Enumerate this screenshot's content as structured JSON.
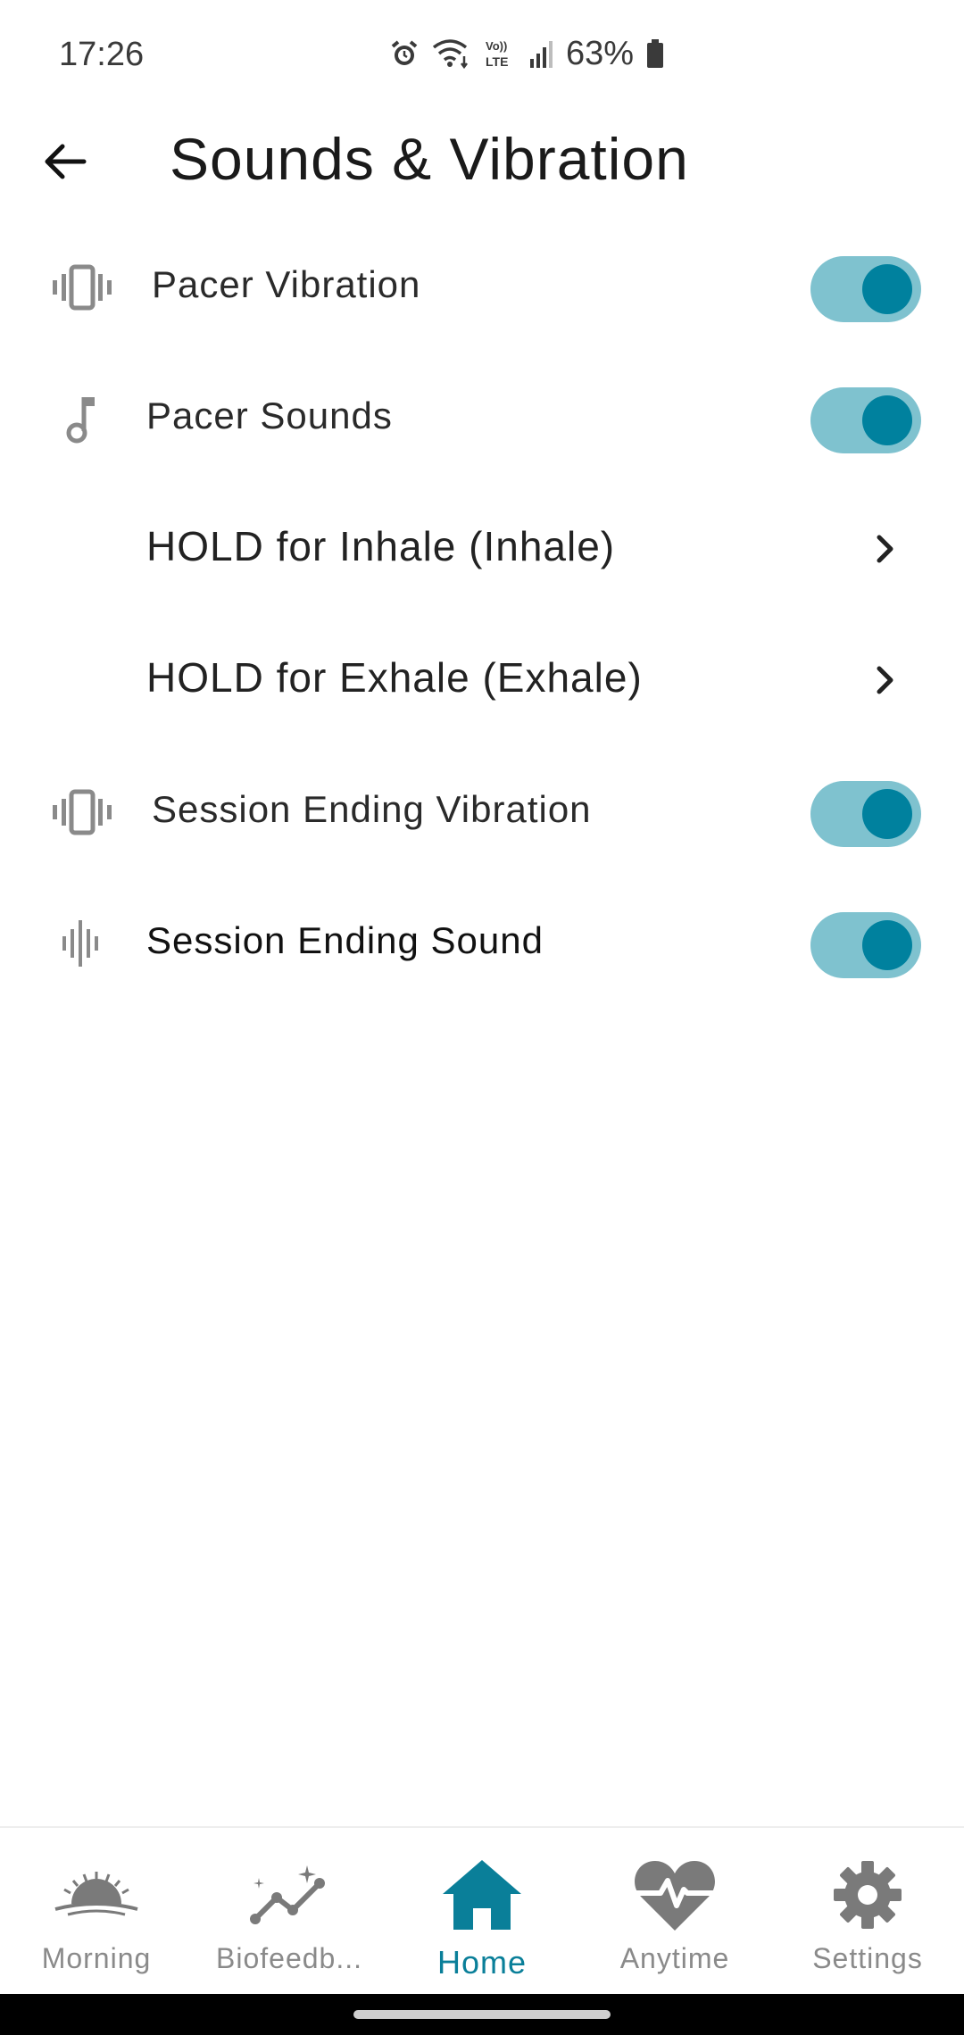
{
  "status_bar": {
    "time": "17:26",
    "battery": "63%",
    "icons": [
      "alarm-icon",
      "wifi-icon",
      "volte-icon",
      "signal-icon",
      "battery-icon"
    ],
    "volte_text": "Vo)) LTE"
  },
  "header": {
    "title": "Sounds & Vibration",
    "back_icon": "arrow-left-icon"
  },
  "settings": {
    "pacer_vibration": {
      "label": "Pacer Vibration",
      "icon": "vibration-icon",
      "enabled": true
    },
    "pacer_sounds": {
      "label": "Pacer Sounds",
      "icon": "music-note-icon",
      "enabled": true
    },
    "inhale_sound": {
      "label": "HOLD for Inhale (Inhale)",
      "icon": "chevron-right-icon"
    },
    "exhale_sound": {
      "label": "HOLD for Exhale (Exhale)",
      "icon": "chevron-right-icon"
    },
    "session_ending_vibration": {
      "label": "Session Ending Vibration",
      "icon": "vibration-icon",
      "enabled": true
    },
    "session_ending_sound": {
      "label": "Session Ending Sound",
      "icon": "sound-wave-icon",
      "enabled": true
    }
  },
  "bottom_nav": {
    "items": [
      {
        "label": "Morning",
        "icon": "sunrise-icon",
        "active": false
      },
      {
        "label": "Biofeedb...",
        "icon": "sparkle-chart-icon",
        "active": false
      },
      {
        "label": "Home",
        "icon": "home-icon",
        "active": true
      },
      {
        "label": "Anytime",
        "icon": "heartbeat-icon",
        "active": false
      },
      {
        "label": "Settings",
        "icon": "gear-icon",
        "active": false
      }
    ]
  },
  "colors": {
    "accent": "#00819e",
    "toggle_track": "#7fc2cf",
    "icon_gray": "#8a8a8a",
    "nav_active": "#0a7f99"
  }
}
